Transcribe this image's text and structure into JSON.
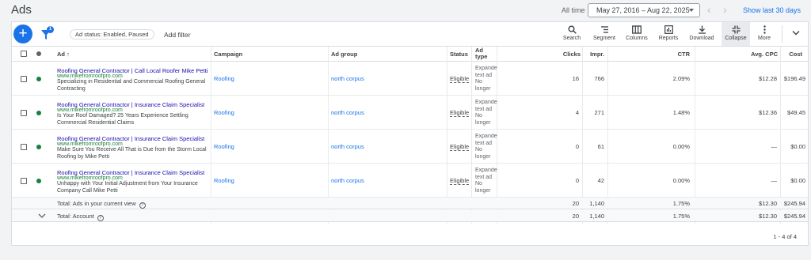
{
  "header": {
    "title": "Ads",
    "date_prefix": "All time",
    "date_range": "May 27, 2016 – Aug 22, 2025",
    "show_last": "Show last 30 days"
  },
  "toolbar": {
    "filter_badge": "1",
    "filter_chip": "Ad status: Enabled, Paused",
    "add_filter": "Add filter",
    "tools": [
      {
        "label": "Search",
        "icon": "search-icon"
      },
      {
        "label": "Segment",
        "icon": "segment-icon"
      },
      {
        "label": "Columns",
        "icon": "columns-icon"
      },
      {
        "label": "Reports",
        "icon": "reports-icon"
      },
      {
        "label": "Download",
        "icon": "download-icon"
      },
      {
        "label": "Collapse",
        "icon": "collapse-icon"
      },
      {
        "label": "More",
        "icon": "more-vert-icon"
      }
    ]
  },
  "columns": {
    "ad": "Ad",
    "campaign": "Campaign",
    "ad_group": "Ad group",
    "status": "Status",
    "ad_type": "Ad type",
    "clicks": "Clicks",
    "impr": "Impr.",
    "ctr": "CTR",
    "avg_cpc": "Avg. CPC",
    "cost": "Cost"
  },
  "rows": [
    {
      "headline": "Roofing General Contractor | Call Local Roofer Mike Petti",
      "url": "www.mikefromroofpro.com",
      "desc": "Specializing in Residential and Commercial Roofing General Contracting",
      "campaign": "Roofing",
      "ad_group": "north corpus",
      "status": "Eligible",
      "ad_type": "Expanded text ad No longer available",
      "clicks": "16",
      "impr": "766",
      "ctr": "2.09%",
      "avg_cpc": "$12.28",
      "cost": "$196.49"
    },
    {
      "headline": "Roofing General Contractor | Insurance Claim Specialist",
      "url": "www.mikefromroofpro.com",
      "desc": "Is Your Roof Damaged? 25 Years Experience Settling Commercial Residential Claims",
      "campaign": "Roofing",
      "ad_group": "north corpus",
      "status": "Eligible",
      "ad_type": "Expanded text ad No longer available",
      "clicks": "4",
      "impr": "271",
      "ctr": "1.48%",
      "avg_cpc": "$12.36",
      "cost": "$49.45"
    },
    {
      "headline": "Roofing General Contractor | Insurance Claim Specialist",
      "url": "www.mikefromroofpro.com",
      "desc": "Make Sure You Receive All That is Due from the Storm Local Roofing by Mike Petti",
      "campaign": "Roofing",
      "ad_group": "north corpus",
      "status": "Eligible",
      "ad_type": "Expanded text ad No longer available",
      "clicks": "0",
      "impr": "61",
      "ctr": "0.00%",
      "avg_cpc": "—",
      "cost": "$0.00"
    },
    {
      "headline": "Roofing General Contractor | Insurance Claim Specialist",
      "url": "www.mikefromroofpro.com",
      "desc": "Unhappy with Your Initial Adjustment from Your Insurance Company Call Mike Petti",
      "campaign": "Roofing",
      "ad_group": "north corpus",
      "status": "Eligible",
      "ad_type": "Expanded text ad No longer available",
      "clicks": "0",
      "impr": "42",
      "ctr": "0.00%",
      "avg_cpc": "—",
      "cost": "$0.00"
    }
  ],
  "totals": [
    {
      "label": "Total: Ads in your current view",
      "clicks": "20",
      "impr": "1,140",
      "ctr": "1.75%",
      "avg_cpc": "$12.30",
      "cost": "$245.94"
    },
    {
      "label": "Total: Account",
      "clicks": "20",
      "impr": "1,140",
      "ctr": "1.75%",
      "avg_cpc": "$12.30",
      "cost": "$245.94"
    }
  ],
  "pager": "1 - 4 of 4",
  "colors": {
    "accent": "#1a73e8",
    "enabled_dot": "#188038",
    "headline": "#1a0dab"
  }
}
